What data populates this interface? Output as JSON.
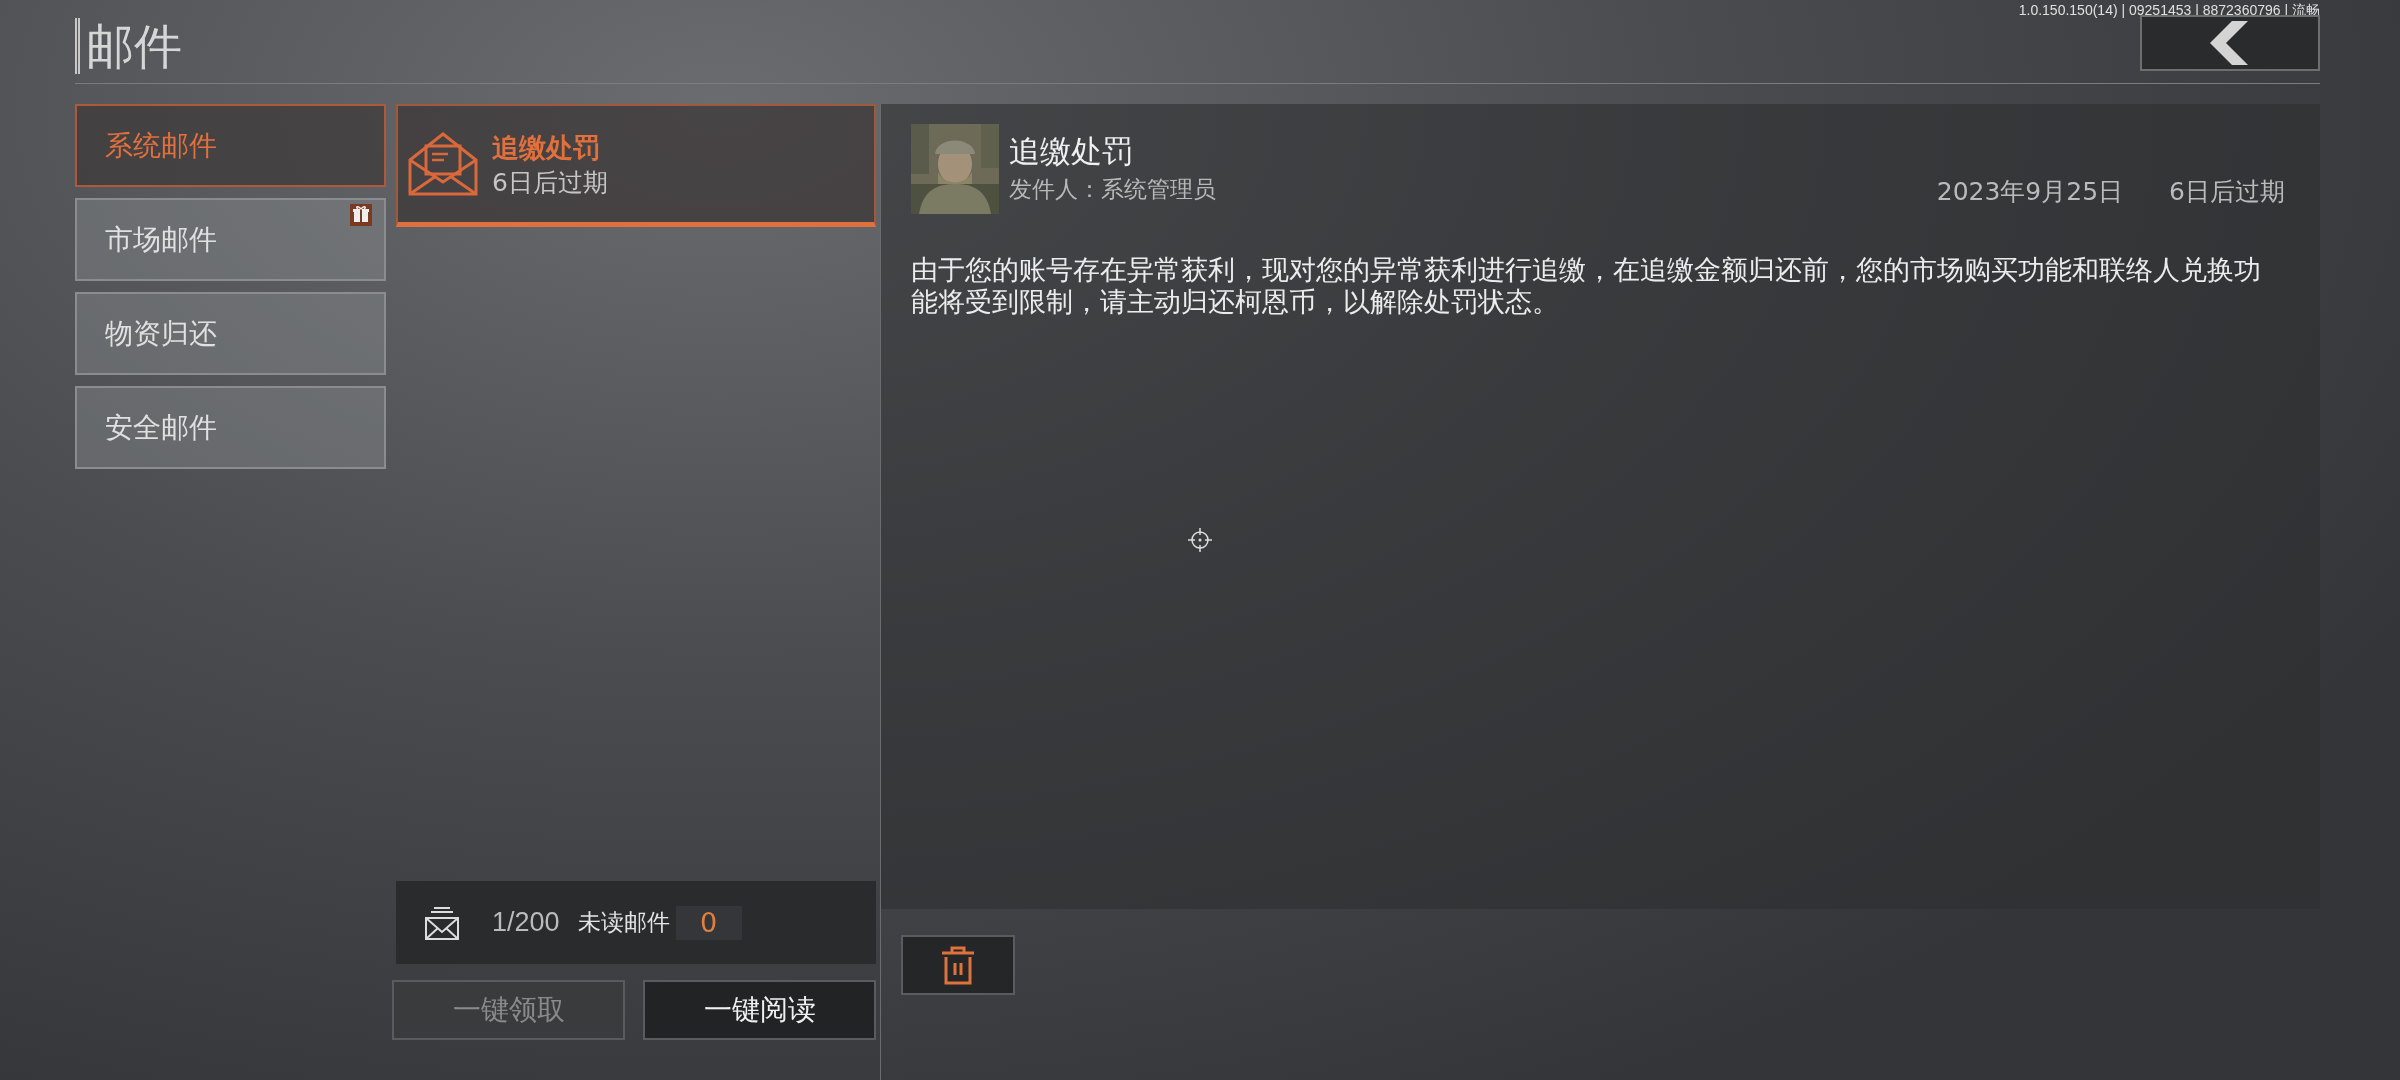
{
  "title": "邮件",
  "version_info": "1.0.150.150(14) | 09251453 | 8872360796 | 流畅",
  "categories": [
    {
      "label": "系统邮件",
      "selected": true,
      "gift_badge": false
    },
    {
      "label": "市场邮件",
      "selected": false,
      "gift_badge": true
    },
    {
      "label": "物资归还",
      "selected": false,
      "gift_badge": false
    },
    {
      "label": "安全邮件",
      "selected": false,
      "gift_badge": false
    }
  ],
  "mail_list": [
    {
      "title": "追缴处罚",
      "expiry": "6日后过期",
      "selected": true
    }
  ],
  "mail_stats": {
    "count": "1/200",
    "unread_label": "未读邮件",
    "unread_count": "0"
  },
  "actions": [
    {
      "label": "一键领取",
      "disabled": true
    },
    {
      "label": "一键阅读",
      "disabled": false
    }
  ],
  "detail": {
    "title": "追缴处罚",
    "sender": "发件人：系统管理员",
    "date": "2023年9月25日",
    "expiry": "6日后过期",
    "body": "由于您的账号存在异常获利，现对您的异常获利进行追缴，在追缴金额归还前，您的市场购买功能和联络人兑换功能将受到限制，请主动归还柯恩币，以解除处罚状态。"
  }
}
